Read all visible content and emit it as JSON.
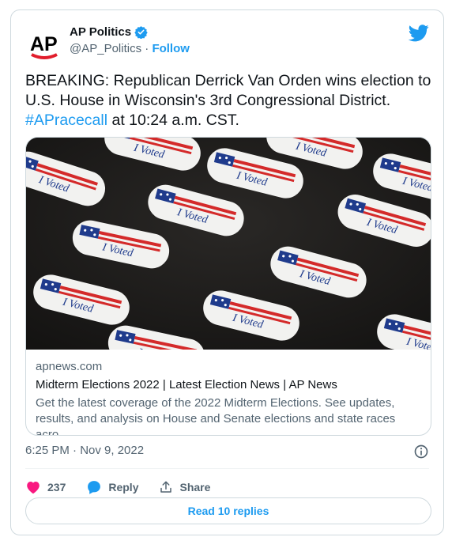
{
  "author": {
    "avatar_text": "AP",
    "name": "AP Politics",
    "handle": "@AP_Politics",
    "separator": " · ",
    "follow_label": "Follow",
    "verified_icon": "verified-badge-icon"
  },
  "tweet": {
    "text_main": "BREAKING: Republican Derrick Van Orden wins election to U.S. House in Wisconsin's 3rd Congressional District. ",
    "hashtag": "#APracecall",
    "text_after": " at 10:24 a.m. CST."
  },
  "link_card": {
    "image_icon": "i-voted-stickers-photo",
    "domain": "apnews.com",
    "title": "Midterm Elections 2022 | Latest Election News | AP News",
    "description": "Get the latest coverage of the 2022 Midterm Elections. See updates, results, and analysis on House and Senate elections and state races acro..."
  },
  "meta": {
    "timestamp": "6:25 PM · Nov 9, 2022",
    "info_icon": "info-icon"
  },
  "actions": {
    "like_count": "237",
    "reply_label": "Reply",
    "share_label": "Share"
  },
  "read_replies_label": "Read 10 replies",
  "colors": {
    "accent": "#1d9bf0",
    "like": "#f91880",
    "text": "#0f1419",
    "muted": "#536471",
    "ap_red": "#e11d2c"
  }
}
